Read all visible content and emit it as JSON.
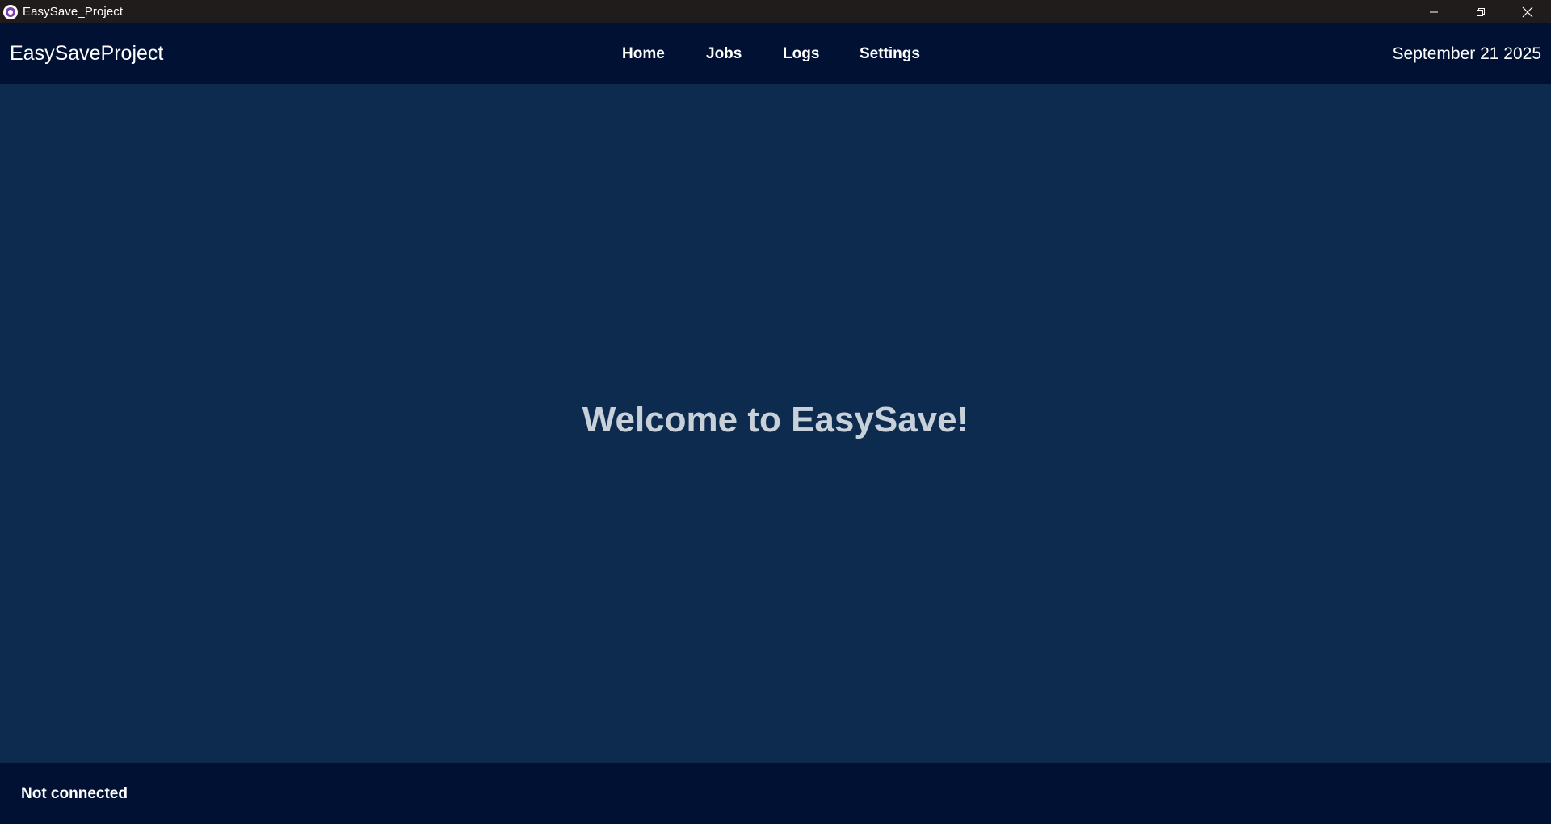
{
  "window": {
    "title": "EasySave_Project",
    "controls": {
      "minimize_icon": "minimize-icon",
      "restore_icon": "restore-icon",
      "close_icon": "close-icon"
    }
  },
  "header": {
    "brand": "EasySaveProject",
    "nav": {
      "home": "Home",
      "jobs": "Jobs",
      "logs": "Logs",
      "settings": "Settings"
    },
    "date": "September 21 2025"
  },
  "main": {
    "welcome": "Welcome to EasySave!"
  },
  "footer": {
    "status": "Not connected"
  },
  "colors": {
    "titlebar_bg": "#211c1c",
    "header_bg": "#001133",
    "main_bg": "#0d2a4f",
    "welcome_text": "#c8d0da",
    "text": "#ffffff"
  }
}
